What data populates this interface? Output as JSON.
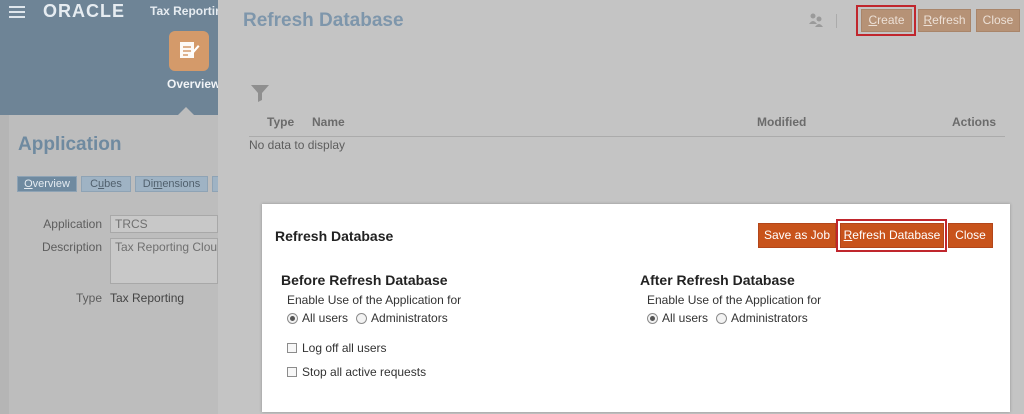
{
  "left_panel": {
    "brand": "ORACLE",
    "app_name": "Tax Reporting",
    "nav_tile_label": "Overview",
    "section_title": "Application",
    "tabs": [
      {
        "prefix": "",
        "mnemonic": "O",
        "rest": "verview"
      },
      {
        "prefix": "C",
        "mnemonic": "u",
        "rest": "bes"
      },
      {
        "prefix": "Di",
        "mnemonic": "m",
        "rest": "ensions"
      }
    ],
    "fields": {
      "application_label": "Application",
      "application_value": "TRCS",
      "description_label": "Description",
      "description_value": "Tax Reporting Cloud",
      "type_label": "Type",
      "type_value": "Tax Reporting"
    }
  },
  "page": {
    "title": "Refresh Database",
    "toolbar": {
      "create": {
        "mnemonic": "C",
        "rest": "reate"
      },
      "refresh": {
        "mnemonic": "R",
        "rest": "efresh"
      },
      "close": "Close"
    },
    "grid": {
      "columns": [
        "Type",
        "Name",
        "Modified",
        "Actions"
      ],
      "empty_text": "No data to display"
    }
  },
  "dialog": {
    "title": "Refresh Database",
    "buttons": {
      "save_as_job": "Save as Job",
      "refresh_database": {
        "mnemonic": "R",
        "rest": "efresh Database"
      },
      "close": "Close"
    },
    "before": {
      "heading": "Before Refresh Database",
      "enable_label": "Enable Use of the Application for",
      "options": [
        "All users",
        "Administrators"
      ],
      "selected": "All users",
      "logoff_label": "Log off all users",
      "stop_label": "Stop all active requests"
    },
    "after": {
      "heading": "After Refresh Database",
      "enable_label": "Enable Use of the Application for",
      "options": [
        "All users",
        "Administrators"
      ],
      "selected": "All users"
    }
  },
  "colors": {
    "primary_button": "#c8531b",
    "highlight_box": "#c0262d",
    "header_blue": "#6e8496"
  }
}
